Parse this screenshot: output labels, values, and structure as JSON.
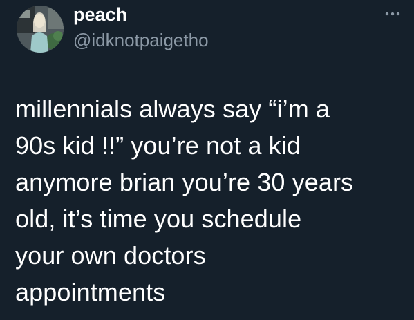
{
  "tweet": {
    "author": {
      "display_name": "peach",
      "handle": "@idknotpaigetho"
    },
    "text": "millennials always say “i’m a\n90s kid !!” you’re not a kid\nanymore brian you’re 30 years\nold, it’s time you schedule\nyour own doctors\nappointments",
    "more_icon": "more-horizontal-icon"
  },
  "colors": {
    "background": "#15202b",
    "text_primary": "#ffffff",
    "text_secondary": "#8b98a5"
  }
}
